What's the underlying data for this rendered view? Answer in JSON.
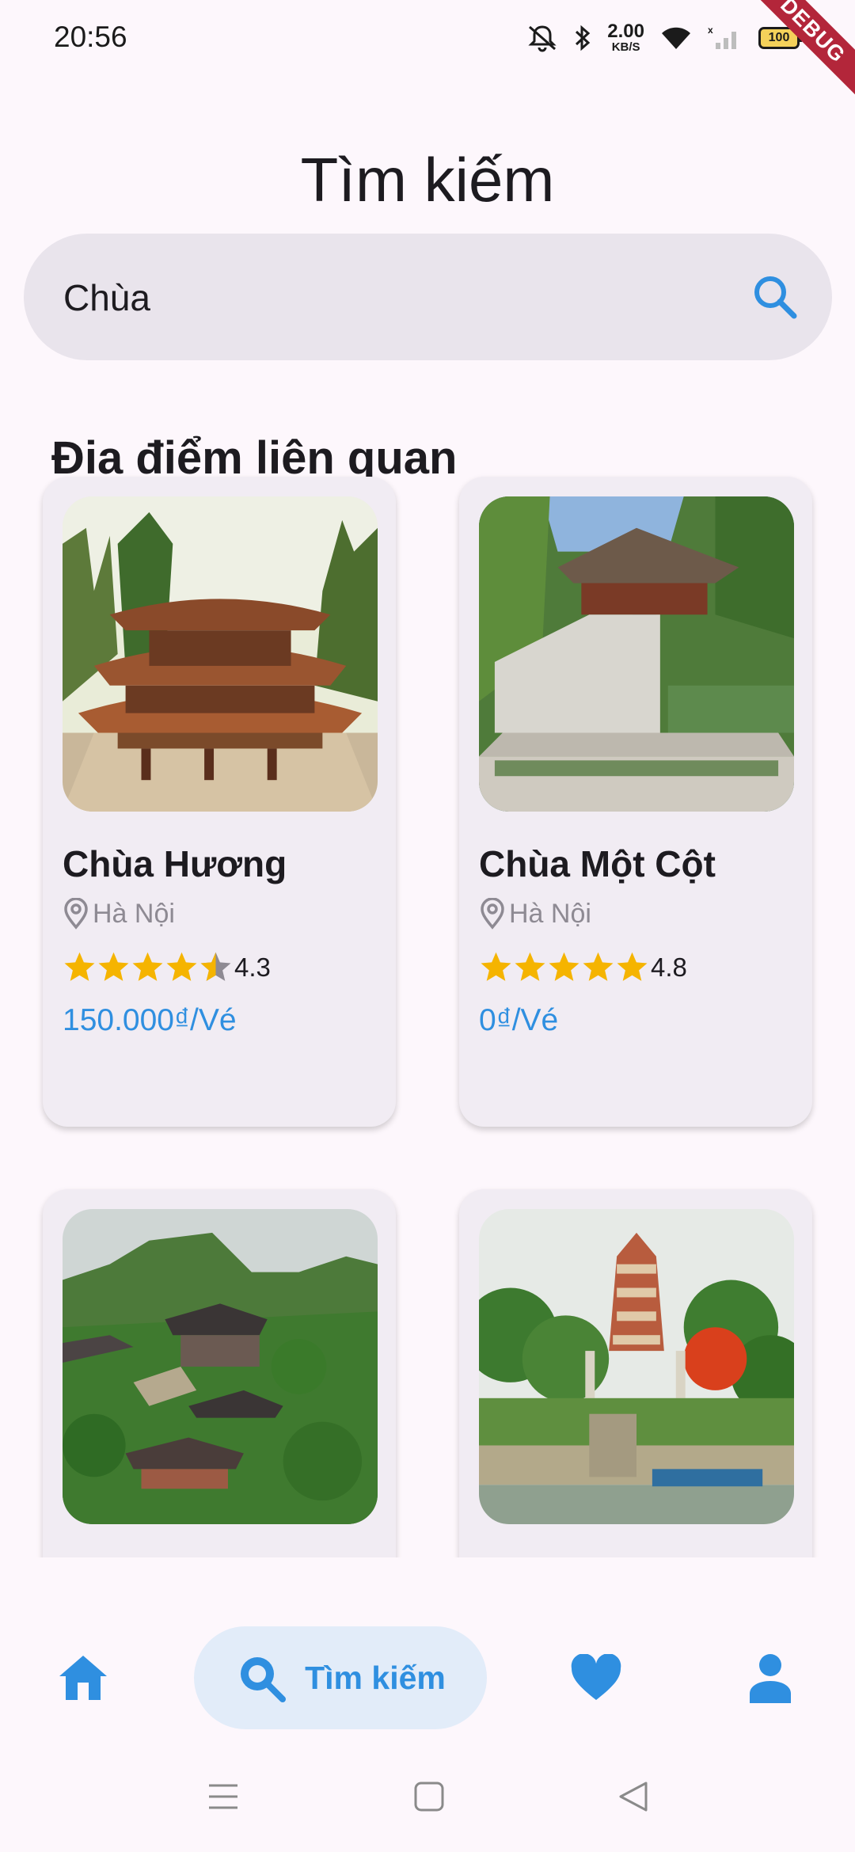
{
  "status_bar": {
    "time": "20:56",
    "net_speed_value": "2.00",
    "net_speed_unit": "KB/S",
    "battery": "100",
    "debug_banner": "DEBUG"
  },
  "page": {
    "title": "Tìm kiếm"
  },
  "search": {
    "value": "Chùa",
    "icon": "search-icon"
  },
  "section": {
    "title": "Địa điểm liên quan"
  },
  "cards": [
    {
      "name": "Chùa Hương",
      "location": "Hà Nội",
      "rating": 4.3,
      "rating_text": "4.3",
      "price": "150.000₫/Vé",
      "image": "pagoda-photo"
    },
    {
      "name": "Chùa Một Cột",
      "location": "Hà Nội",
      "rating": 4.8,
      "rating_text": "4.8",
      "price": "0₫/Vé",
      "image": "one-pillar-pagoda-photo"
    },
    {
      "name": "",
      "location": "",
      "image": "mountain-temple-photo"
    },
    {
      "name": "",
      "location": "",
      "image": "tower-pagoda-photo"
    }
  ],
  "bottom_nav": {
    "items": [
      {
        "icon": "home-icon",
        "label": ""
      },
      {
        "icon": "search-icon",
        "label": "Tìm kiếm"
      },
      {
        "icon": "heart-icon",
        "label": ""
      },
      {
        "icon": "person-icon",
        "label": ""
      }
    ],
    "active": 1
  },
  "colors": {
    "accent": "#2f8fe0",
    "star": "#f5b400",
    "card_bg": "#f1ecf3",
    "search_bg": "#e9e4ec"
  }
}
